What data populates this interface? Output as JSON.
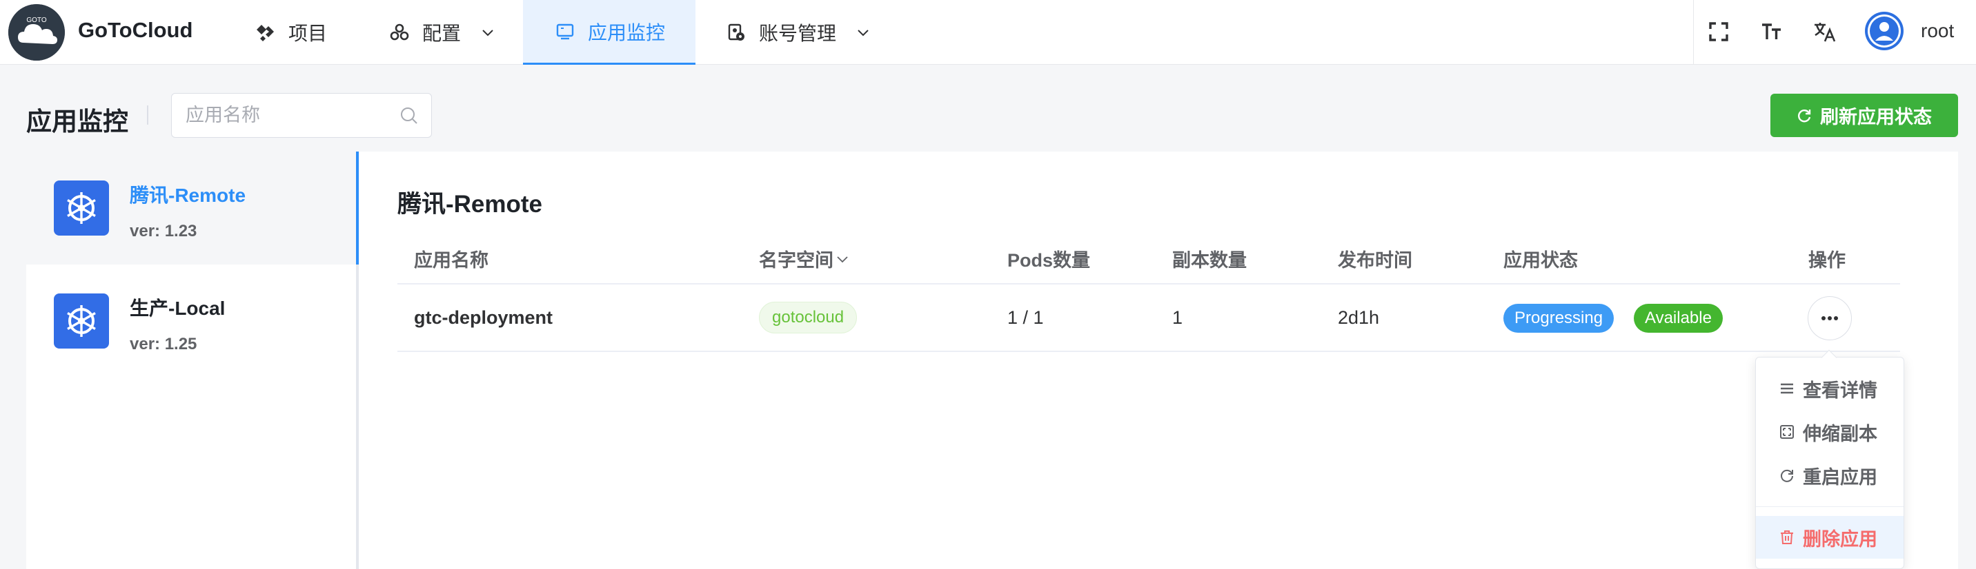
{
  "brand": {
    "name": "GoToCloud",
    "logo_text": "GOTO"
  },
  "nav": {
    "items": [
      {
        "label": "项目",
        "icon": "project-icon",
        "has_dropdown": false
      },
      {
        "label": "配置",
        "icon": "config-icon",
        "has_dropdown": true
      },
      {
        "label": "应用监控",
        "icon": "monitor-icon",
        "has_dropdown": false,
        "active": true
      },
      {
        "label": "账号管理",
        "icon": "account-icon",
        "has_dropdown": true
      }
    ]
  },
  "toolbar": {
    "icons": [
      "fullscreen-icon",
      "font-size-icon",
      "translate-icon",
      "avatar"
    ],
    "username": "root"
  },
  "page": {
    "title": "应用监控",
    "search_placeholder": "应用名称",
    "refresh_label": "刷新应用状态"
  },
  "clusters": [
    {
      "name": "腾讯-Remote",
      "version": "ver: 1.23",
      "active": true
    },
    {
      "name": "生产-Local",
      "version": "ver: 1.25",
      "active": false
    }
  ],
  "main": {
    "title": "腾讯-Remote",
    "columns": [
      "应用名称",
      "名字空间",
      "Pods数量",
      "副本数量",
      "发布时间",
      "应用状态",
      "操作"
    ],
    "rows": [
      {
        "name": "gtc-deployment",
        "namespace": "gotocloud",
        "pods": "1 / 1",
        "replicas": "1",
        "age": "2d1h",
        "statuses": [
          "Progressing",
          "Available"
        ]
      }
    ]
  },
  "dropdown": {
    "items": [
      {
        "label": "查看详情",
        "icon": "list-icon"
      },
      {
        "label": "伸缩副本",
        "icon": "scale-icon"
      },
      {
        "label": "重启应用",
        "icon": "restart-icon"
      },
      {
        "label": "删除应用",
        "icon": "delete-icon",
        "danger": true
      }
    ]
  },
  "colors": {
    "accent": "#2c8ef8",
    "success": "#3cb13c",
    "danger": "#f56c6c",
    "kubernetes": "#326de6"
  }
}
